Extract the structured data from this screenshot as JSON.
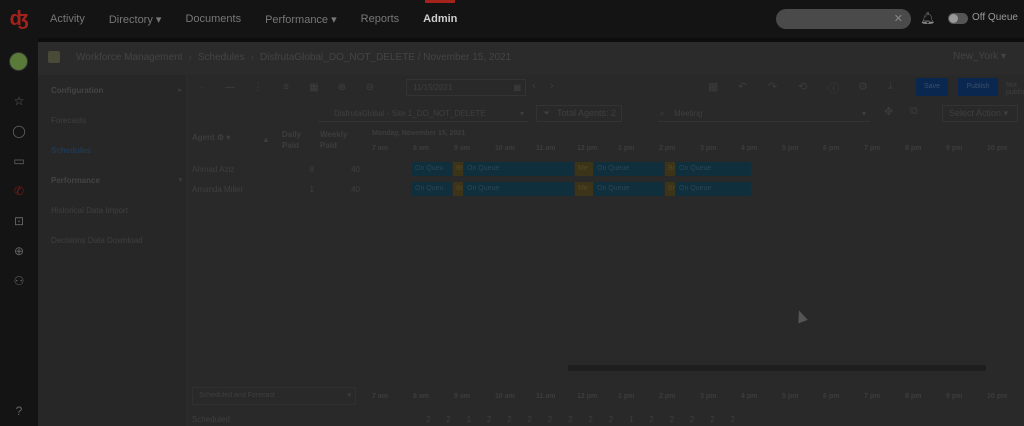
{
  "nav": {
    "items": [
      "Activity",
      "Directory ▾",
      "Documents",
      "Performance ▾",
      "Reports",
      "Admin"
    ],
    "status": "Off Queue"
  },
  "breadcrumb": {
    "items": [
      "Workforce Management",
      "Schedules",
      "DisfrutaGlobal_DO_NOT_DELETE / November 15, 2021"
    ],
    "timezone": "New_York"
  },
  "sidebar": {
    "items": [
      {
        "label": "Configuration",
        "style": "bold"
      },
      {
        "label": "Forecasts",
        "style": ""
      },
      {
        "label": "Schedules",
        "style": "sel"
      },
      {
        "label": "Performance",
        "style": "bold"
      },
      {
        "label": "Historical Data Import",
        "style": ""
      },
      {
        "label": "Decisions Data Download",
        "style": ""
      }
    ]
  },
  "toolbar": {
    "date": "11/15/2021",
    "save": "Save",
    "publish": "Publish",
    "status": "Not published",
    "site": "DisfrutaGlobal - Site 1_DO_NOT_DELETE",
    "agents": "Total Agents: 2",
    "activity": "Meeting",
    "select_action": "Select Action"
  },
  "grid": {
    "col_agent": "Agent",
    "col_daily": [
      "Daily",
      "Paid"
    ],
    "col_weekly": [
      "Weekly",
      "Paid"
    ],
    "day": "Monday, November 15, 2021",
    "hours": [
      "7 am",
      "8 am",
      "9 am",
      "10 am",
      "11 am",
      "12 pm",
      "1 pm",
      "2 pm",
      "3 pm",
      "4 pm",
      "5 pm",
      "6 pm",
      "7 pm",
      "8 pm",
      "9 pm",
      "10 pm"
    ],
    "agents": [
      {
        "name": "Ahmad Aziz",
        "daily": "8",
        "weekly": "40"
      },
      {
        "name": "Amanda Miller",
        "daily": "1",
        "weekly": "40"
      }
    ],
    "segments": [
      {
        "label": "On Queu",
        "kind": "q"
      },
      {
        "label": "Br",
        "kind": "b"
      },
      {
        "label": "On Queue",
        "kind": "q"
      },
      {
        "label": "Me",
        "kind": "b"
      },
      {
        "label": "On Queue",
        "kind": "q"
      },
      {
        "label": "Br",
        "kind": "b"
      },
      {
        "label": "On Queue",
        "kind": "q"
      }
    ]
  },
  "bottom": {
    "selector": "Scheduled and Forecast",
    "row_label": "Scheduled",
    "counts": [
      "2",
      "2",
      "1",
      "2",
      "2",
      "2",
      "2",
      "2",
      "2",
      "2",
      "1",
      "2",
      "2",
      "2",
      "2",
      "2"
    ]
  }
}
